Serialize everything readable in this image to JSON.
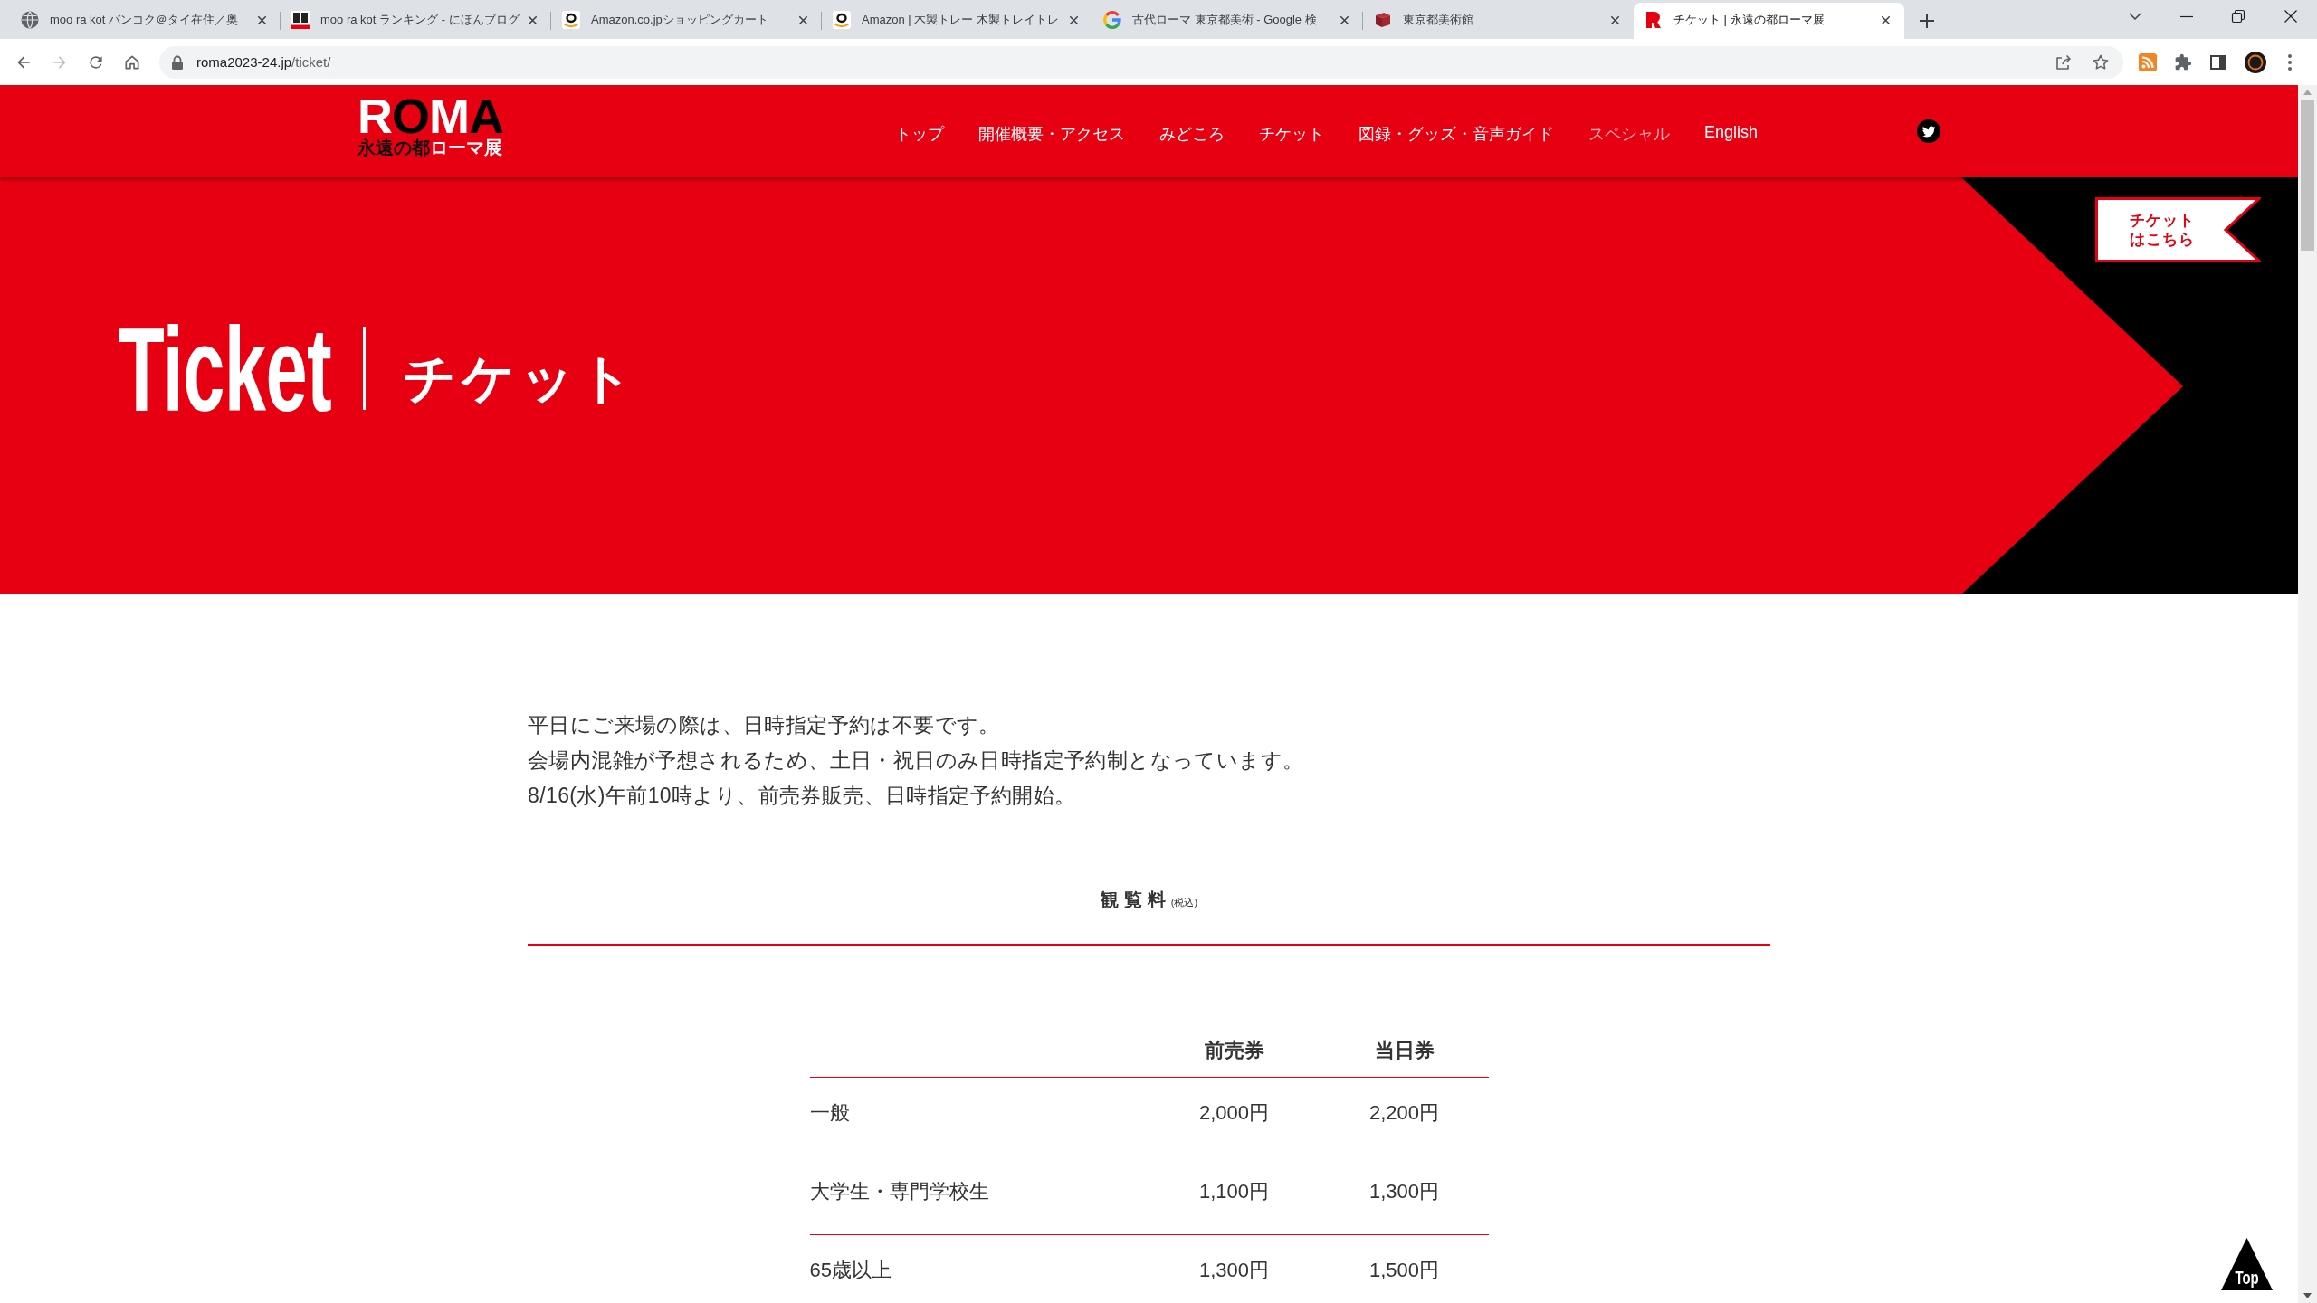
{
  "browser": {
    "tabs": [
      {
        "title": "moo ra kot バンコク＠タイ在住／奥",
        "selected": false
      },
      {
        "title": "moo ra kot ランキング - にほんブログ",
        "selected": false
      },
      {
        "title": "Amazon.co.jpショッピングカート",
        "selected": false
      },
      {
        "title": "Amazon | 木製トレー 木製トレイトレ",
        "selected": false
      },
      {
        "title": "古代ローマ 東京都美術 - Google 検",
        "selected": false
      },
      {
        "title": "東京都美術館",
        "selected": false
      },
      {
        "title": "チケット | 永遠の都ローマ展",
        "selected": true
      }
    ],
    "address_bar": {
      "host": "roma2023-24.jp",
      "path": "/ticket/",
      "can_go_forward": false
    }
  },
  "site_header": {
    "logo": {
      "wordmark": "ROMA",
      "subtitle": [
        "永遠の都",
        "ローマ展"
      ]
    },
    "nav": [
      {
        "label": "トップ",
        "disabled": false
      },
      {
        "label": "開催概要・アクセス",
        "disabled": false
      },
      {
        "label": "みどころ",
        "disabled": false
      },
      {
        "label": "チケット",
        "disabled": false
      },
      {
        "label": "図録・グッズ・音声ガイド",
        "disabled": false
      },
      {
        "label": "スペシャル",
        "disabled": true
      },
      {
        "label": "English",
        "disabled": false
      }
    ]
  },
  "hero": {
    "title_en": "Ticket",
    "title_ja": "チケット",
    "ticket_button": [
      "チケット",
      "はこちら"
    ]
  },
  "intro": [
    "平日にご来場の際は、日時指定予約は不要です。",
    "会場内混雑が予想されるため、土日・祝日のみ日時指定予約制となっています。",
    "8/16(水)午前10時より、前売券販売、日時指定予約開始。"
  ],
  "prices": {
    "heading": "観覧料$_{(税込)}$",
    "columns": [
      "前売券",
      "当日券"
    ],
    "rows": [
      {
        "label": "一般",
        "cells": [
          "2,000円",
          "2,200円"
        ]
      },
      {
        "label": "大学生・専門学校生",
        "cells": [
          "1,100円",
          "1,300円"
        ]
      },
      {
        "label": "65歳以上",
        "cells": [
          "1,300円",
          "1,500円"
        ]
      }
    ]
  },
  "back_to_top": "Top"
}
